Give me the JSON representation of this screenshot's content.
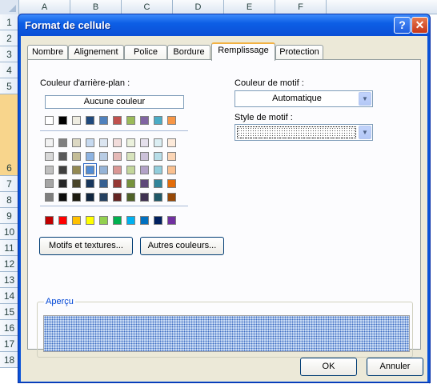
{
  "spreadsheet": {
    "columns": [
      "A",
      "B",
      "C",
      "D",
      "E",
      "F"
    ],
    "rows": [
      "1",
      "2",
      "3",
      "4",
      "5",
      "6",
      "7",
      "8",
      "9",
      "10",
      "11",
      "12",
      "13",
      "14",
      "15",
      "16",
      "17",
      "18"
    ],
    "selected_row": "6"
  },
  "dialog": {
    "title": "Format de cellule",
    "help_label": "?",
    "close_label": "✕",
    "tabs": [
      "Nombre",
      "Alignement",
      "Police",
      "Bordure",
      "Remplissage",
      "Protection"
    ],
    "active_tab": "Remplissage",
    "background": {
      "label": "Couleur d'arrière-plan :",
      "no_color_label": "Aucune couleur",
      "theme_row": [
        "#ffffff",
        "#000000",
        "#eeece1",
        "#1f497d",
        "#4f81bd",
        "#c0504d",
        "#9bbb59",
        "#8064a2",
        "#4bacc6",
        "#f79646"
      ],
      "tints": [
        [
          "#f2f2f2",
          "#7f7f7f",
          "#ddd9c3",
          "#c6d9f0",
          "#dbe5f1",
          "#f2dcdb",
          "#ebf1dd",
          "#e5e0ec",
          "#dbeef3",
          "#fdeada"
        ],
        [
          "#d8d8d8",
          "#595959",
          "#c4bd97",
          "#8db3e2",
          "#b8cce4",
          "#e5b9b7",
          "#d7e3bc",
          "#ccc1d9",
          "#b7dde8",
          "#fbd5b5"
        ],
        [
          "#bfbfbf",
          "#3f3f3f",
          "#938953",
          "#548dd4",
          "#95b3d7",
          "#d99694",
          "#c3d69b",
          "#b2a2c7",
          "#92cddc",
          "#fac08f"
        ],
        [
          "#a5a5a5",
          "#262626",
          "#494429",
          "#17365d",
          "#366092",
          "#953734",
          "#76923c",
          "#5f497a",
          "#31859b",
          "#e36c09"
        ],
        [
          "#7f7f7f",
          "#0c0c0c",
          "#1d1b10",
          "#0f243e",
          "#244061",
          "#632423",
          "#4f6128",
          "#3f3151",
          "#205867",
          "#974806"
        ]
      ],
      "selected_swatch": "#548dd4",
      "standard": [
        "#c00000",
        "#ff0000",
        "#ffc000",
        "#ffff00",
        "#92d050",
        "#00b050",
        "#00b0f0",
        "#0070c0",
        "#002060",
        "#7030a0"
      ],
      "fill_effects_label": "Motifs et textures...",
      "more_colors_label": "Autres couleurs..."
    },
    "pattern": {
      "color_label": "Couleur de motif :",
      "color_value": "Automatique",
      "style_label": "Style de motif :"
    },
    "preview_label": "Aperçu",
    "ok_label": "OK",
    "cancel_label": "Annuler"
  }
}
